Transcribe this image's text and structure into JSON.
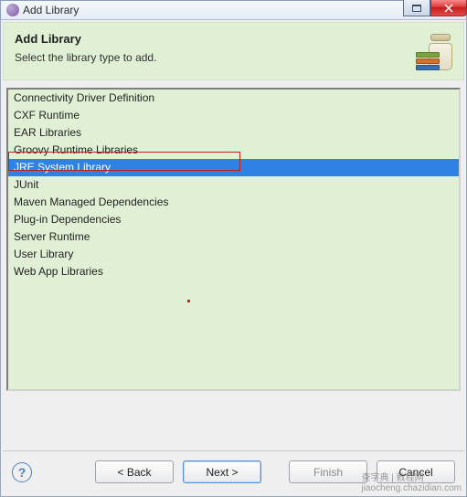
{
  "window": {
    "title": "Add Library"
  },
  "header": {
    "title": "Add Library",
    "subtitle": "Select the library type to add."
  },
  "libraries": {
    "items": [
      "Connectivity Driver Definition",
      "CXF Runtime",
      "EAR Libraries",
      "Groovy Runtime Libraries",
      "JRE System Library",
      "JUnit",
      "Maven Managed Dependencies",
      "Plug-in Dependencies",
      "Server Runtime",
      "User Library",
      "Web App Libraries"
    ],
    "selected_index": 4
  },
  "buttons": {
    "back": "< Back",
    "next": "Next >",
    "finish": "Finish",
    "cancel": "Cancel"
  },
  "help_tooltip": "?"
}
